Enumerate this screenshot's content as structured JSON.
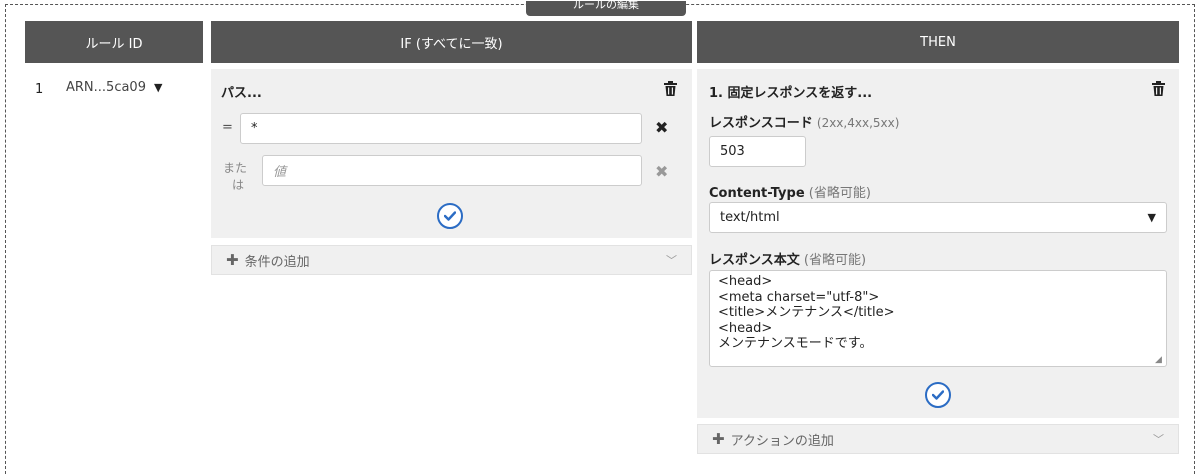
{
  "legend": "ルールの編集",
  "headers": {
    "rule_id": "ルール ID",
    "if": "IF (すべてに一致)",
    "then": "THEN"
  },
  "rule": {
    "number": "1",
    "id": "ARN...5ca09"
  },
  "condition": {
    "title": "パス...",
    "eq_symbol": "=",
    "value": "*",
    "or_label_1": "また",
    "or_label_2": "は",
    "value_placeholder": "値",
    "add_condition": "条件の追加"
  },
  "action": {
    "title": "1. 固定レスポンスを返す...",
    "response_code_label": "レスポンスコード",
    "response_code_hint": "(2xx,4xx,5xx)",
    "response_code_value": "503",
    "content_type_label": "Content-Type",
    "optional_hint": "(省略可能)",
    "content_type_value": "text/html",
    "body_label": "レスポンス本文",
    "body_value": "<head>\n<meta charset=\"utf-8\">\n<title>メンテナンス</title>\n<head>\nメンテナンスモードです。",
    "add_action": "アクションの追加"
  },
  "colors": {
    "header_bg": "#555555",
    "panel_bg": "#f0f0f0",
    "accent": "#2b6cc4"
  }
}
